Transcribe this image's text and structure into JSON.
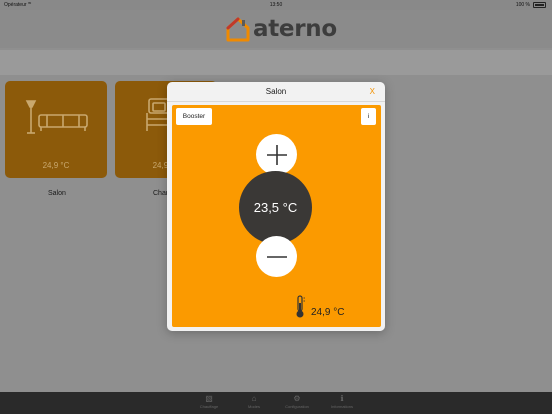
{
  "status_bar": {
    "carrier": "Opérateur",
    "wifi_icon": "wifi-icon",
    "time": "13:50",
    "battery_pct": "100 %",
    "battery_icon": "battery-icon"
  },
  "header": {
    "logo_icon": "house-logo-icon",
    "logo_text": "aterno"
  },
  "rooms": [
    {
      "name": "Salon",
      "temp": "24,9 °C",
      "icon": "sofa-lamp-icon"
    },
    {
      "name": "Chan",
      "temp": "24,9 °C",
      "icon": "bed-icon"
    }
  ],
  "modal": {
    "title": "Salon",
    "close_label": "X",
    "booster_label": "Booster",
    "info_label": "i",
    "plus_icon": "plus-icon",
    "minus_icon": "minus-icon",
    "setpoint": "23,5 °C",
    "thermometer_icon": "thermometer-icon",
    "measured_temp": "24,9 °C"
  },
  "colors": {
    "accent": "#fb9a00",
    "tile_dimmed": "#8c5a0a",
    "setpoint_bg": "#3a3836"
  },
  "tab_bar": {
    "tabs": [
      {
        "label": "Chauffage",
        "icon": "thermometer-tab-icon"
      },
      {
        "label": "Modes",
        "icon": "home-tab-icon"
      },
      {
        "label": "Configuration",
        "icon": "settings-tab-icon"
      },
      {
        "label": "Informations",
        "icon": "info-tab-icon"
      }
    ]
  }
}
